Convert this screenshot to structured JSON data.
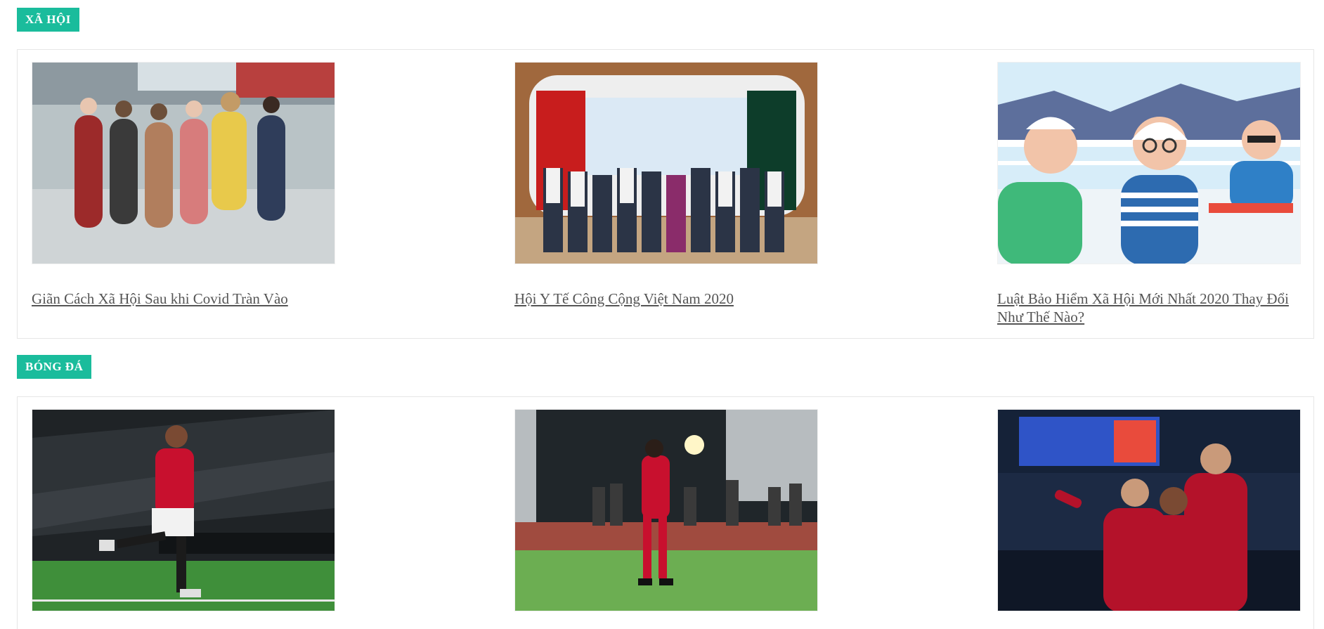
{
  "theme": {
    "tag_color": "#1abc9c"
  },
  "sections": [
    {
      "tag": "XÃ HỘI",
      "articles": [
        {
          "title": "Giãn Cách Xã Hội Sau khi Covid Tràn Vào",
          "image": "crowd-masked-airport-photo"
        },
        {
          "title": "Hội Y Tế Công Cộng Việt Nam 2020",
          "image": "conference-group-photo"
        },
        {
          "title": "Luật Bảo Hiểm Xã Hội Mới Nhất 2020 Thay Đổi Như Thế Nào?",
          "image": "elderly-cartoon-illustration"
        }
      ]
    },
    {
      "tag": "BÓNG ĐÁ",
      "articles": [
        {
          "title": "",
          "image": "football-player-red-kit-photo"
        },
        {
          "title": "",
          "image": "vietnam-player-walking-photo"
        },
        {
          "title": "",
          "image": "players-celebrating-photo"
        }
      ]
    }
  ]
}
